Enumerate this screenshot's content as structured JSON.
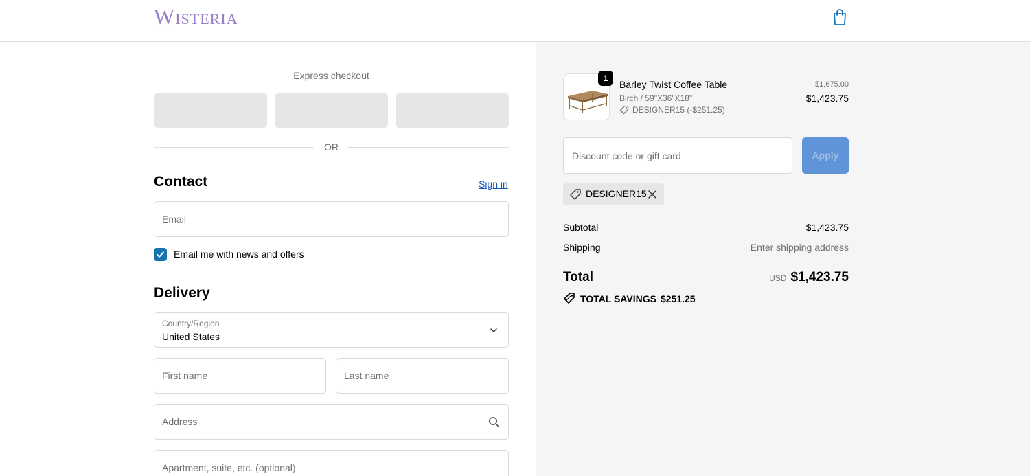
{
  "header": {
    "logo": "Wisteria",
    "cart_icon": "shopping-bag-icon"
  },
  "express": {
    "title": "Express checkout",
    "or": "OR"
  },
  "contact": {
    "title": "Contact",
    "sign_in": "Sign in",
    "email_placeholder": "Email",
    "newsletter_label": "Email me with news and offers",
    "newsletter_checked": true
  },
  "delivery": {
    "title": "Delivery",
    "country_label": "Country/Region",
    "country_value": "United States",
    "first_name_placeholder": "First name",
    "last_name_placeholder": "Last name",
    "address_placeholder": "Address",
    "apartment_placeholder": "Apartment, suite, etc. (optional)"
  },
  "order": {
    "item": {
      "quantity": "1",
      "name": "Barley Twist Coffee Table",
      "variant": "Birch / 59\"X36\"X18\"",
      "discount": "DESIGNER15 (-$251.25)",
      "original_price": "$1,675.00",
      "price": "$1,423.75"
    },
    "discount_placeholder": "Discount code or gift card",
    "apply_label": "Apply",
    "applied_code": "DESIGNER15",
    "subtotal_label": "Subtotal",
    "subtotal_value": "$1,423.75",
    "shipping_label": "Shipping",
    "shipping_value": "Enter shipping address",
    "total_label": "Total",
    "currency": "USD",
    "total_value": "$1,423.75",
    "savings_label": "TOTAL SAVINGS",
    "savings_value": "$251.25"
  },
  "colors": {
    "brand": "#9b7ec8",
    "accent": "#1773b0",
    "apply_button": "#5f94d9"
  }
}
